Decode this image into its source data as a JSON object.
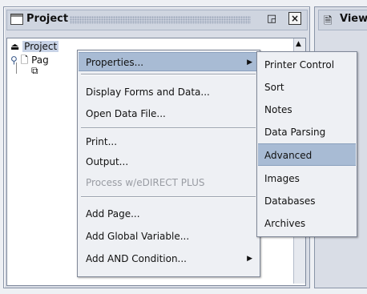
{
  "project_panel": {
    "title": "Project",
    "maximize_glyph": "◲",
    "close_glyph": "☒"
  },
  "right_panel": {
    "title": "View"
  },
  "tree": {
    "root_label": "Project",
    "page_label": "Pag"
  },
  "context_menu": {
    "items": [
      {
        "label": "Properties...",
        "has_submenu": true,
        "highlighted": true
      },
      {
        "label": "Display Forms and Data..."
      },
      {
        "label": "Open Data File..."
      },
      {
        "label": "Print..."
      },
      {
        "label": "Output..."
      },
      {
        "label": "Process w/eDIRECT PLUS",
        "disabled": true
      },
      {
        "label": "Add Page..."
      },
      {
        "label": "Add Global Variable..."
      },
      {
        "label": "Add AND Condition...",
        "has_submenu": true
      }
    ]
  },
  "submenu": {
    "items": [
      {
        "label": "Printer Control"
      },
      {
        "label": "Sort"
      },
      {
        "label": "Notes"
      },
      {
        "label": "Data Parsing"
      },
      {
        "label": "Advanced",
        "highlighted": true
      },
      {
        "label": "Images"
      },
      {
        "label": "Databases"
      },
      {
        "label": "Archives"
      }
    ]
  },
  "icons": {
    "window": "window-icon",
    "maximize": "maximize-icon",
    "close": "close-icon",
    "project": "project-icon",
    "page": "page-icon",
    "copy": "copy-icon",
    "document": "document-icon",
    "submenu_arrow": "chevron-right-icon"
  }
}
